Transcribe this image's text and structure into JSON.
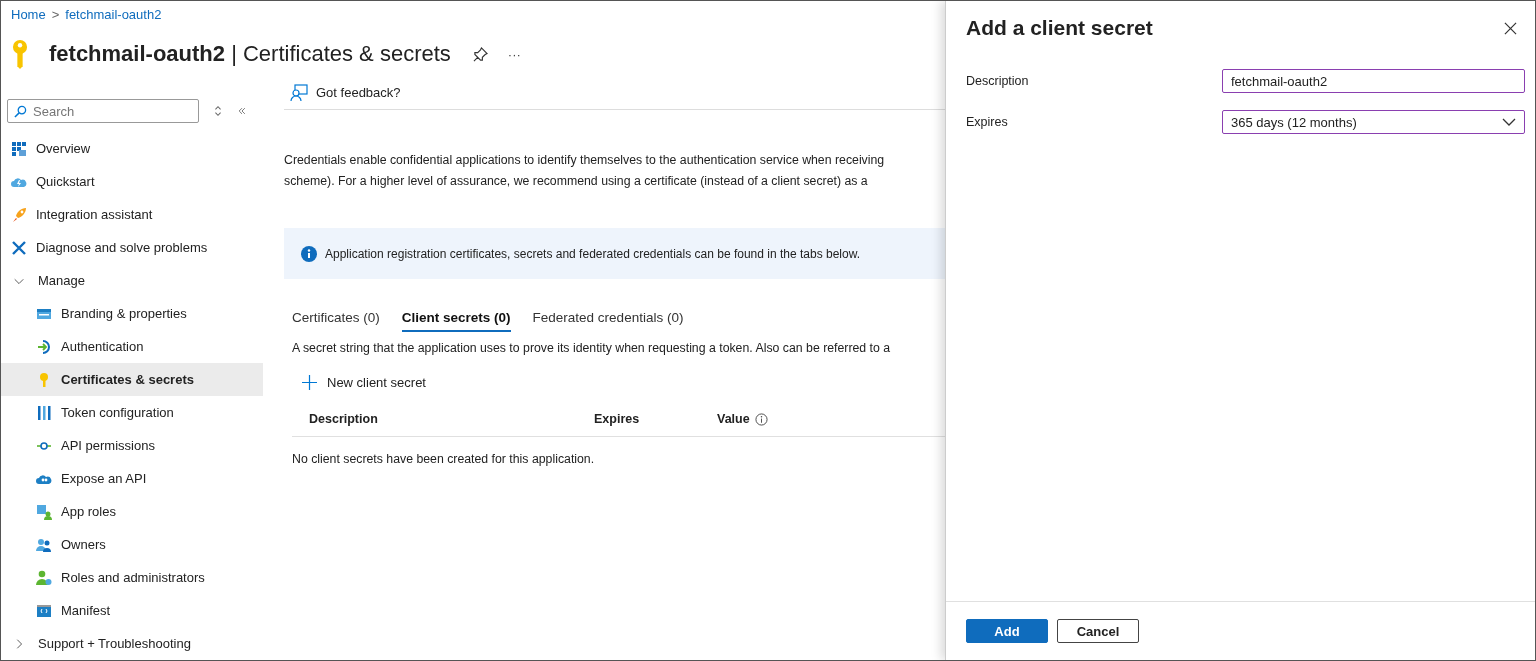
{
  "breadcrumb": [
    "Home",
    "fetchmail-oauth2"
  ],
  "breadcrumb_separator": ">",
  "header": {
    "app": "fetchmail-oauth2",
    "separator": "|",
    "page": "Certificates & secrets",
    "more": "···"
  },
  "sidebar": {
    "search": {
      "placeholder": "Search"
    },
    "items": [
      {
        "label": "Overview",
        "kind": "page",
        "selected": false
      },
      {
        "label": "Quickstart",
        "kind": "page",
        "selected": false
      },
      {
        "label": "Integration assistant",
        "kind": "page",
        "selected": false
      },
      {
        "label": "Diagnose and solve problems",
        "kind": "page",
        "selected": false
      },
      {
        "label": "Manage",
        "kind": "group",
        "expanded": true,
        "selected": false,
        "children": [
          {
            "label": "Branding & properties",
            "selected": false
          },
          {
            "label": "Authentication",
            "selected": false
          },
          {
            "label": "Certificates & secrets",
            "selected": true
          },
          {
            "label": "Token configuration",
            "selected": false
          },
          {
            "label": "API permissions",
            "selected": false
          },
          {
            "label": "Expose an API",
            "selected": false
          },
          {
            "label": "App roles",
            "selected": false
          },
          {
            "label": "Owners",
            "selected": false
          },
          {
            "label": "Roles and administrators",
            "selected": false
          },
          {
            "label": "Manifest",
            "selected": false
          }
        ]
      },
      {
        "label": "Support + Troubleshooting",
        "kind": "group",
        "expanded": false,
        "selected": false
      }
    ]
  },
  "toolbar": {
    "feedback": "Got feedback?"
  },
  "intro": [
    "Credentials enable confidential applications to identify themselves to the authentication service when receiving",
    "scheme). For a higher level of assurance, we recommend using a certificate (instead of a client secret) as a"
  ],
  "info_banner": "Application registration certificates, secrets and federated credentials can be found in the tabs below.",
  "tabs": [
    {
      "label": "Certificates (0)",
      "selected": false
    },
    {
      "label": "Client secrets (0)",
      "selected": true
    },
    {
      "label": "Federated credentials (0)",
      "selected": false
    }
  ],
  "tab_description": "A secret string that the application uses to prove its identity when requesting a token. Also can be referred to a",
  "new_button": "New client secret",
  "table": {
    "columns": [
      "Description",
      "Expires",
      "Value"
    ],
    "empty": "No client secrets have been created for this application."
  },
  "panel": {
    "title": "Add a client secret",
    "fields": [
      {
        "label": "Description",
        "kind": "text",
        "value": "fetchmail-oauth2"
      },
      {
        "label": "Expires",
        "kind": "select",
        "value": "365 days (12 months)"
      }
    ],
    "buttons": [
      {
        "label": "Add",
        "primary": true
      },
      {
        "label": "Cancel",
        "primary": false
      }
    ]
  }
}
